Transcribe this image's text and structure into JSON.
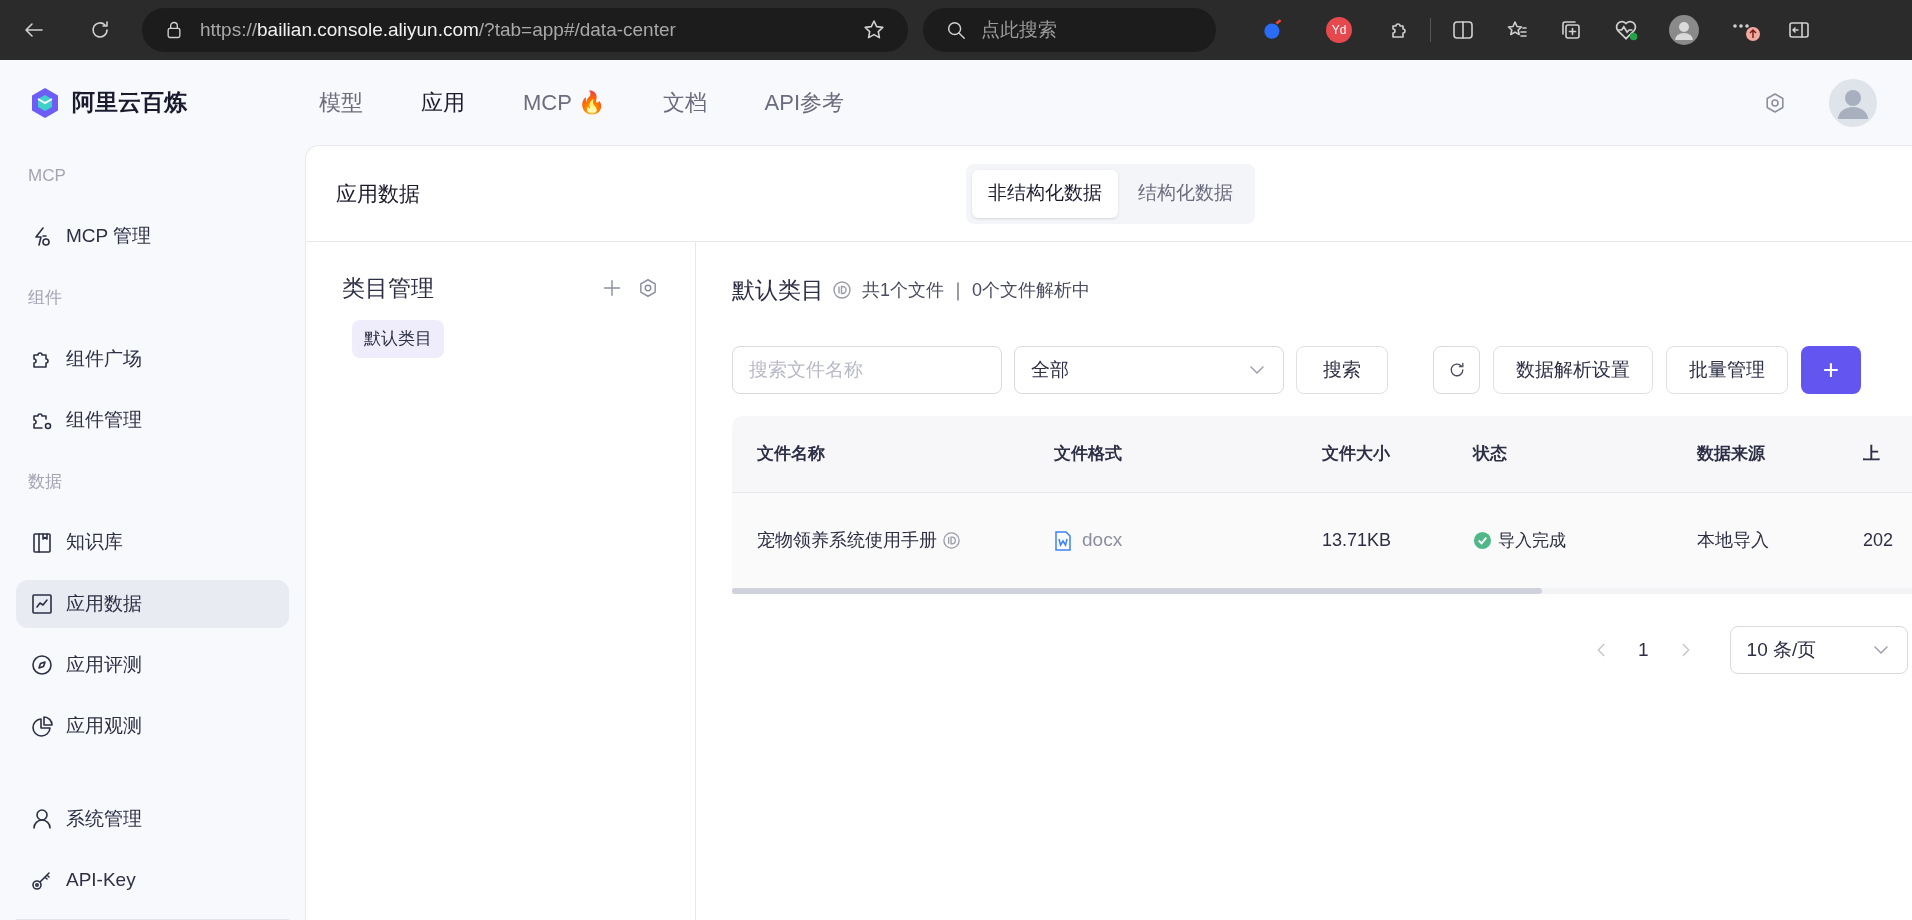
{
  "browser": {
    "url": {
      "prefix": "https://",
      "domain": "bailian.console.aliyun.com",
      "path": "/?tab=app#/data-center"
    },
    "search_placeholder": "点此搜索",
    "extension_badge": "Yd"
  },
  "header": {
    "brand": "阿里云百炼",
    "nav": [
      {
        "label": "模型",
        "selected": false
      },
      {
        "label": "应用",
        "selected": true
      },
      {
        "label": "MCP 🔥",
        "selected": false
      },
      {
        "label": "文档",
        "selected": false
      },
      {
        "label": "API参考",
        "selected": false
      }
    ]
  },
  "sidebar": {
    "entries": [
      {
        "kind": "heading",
        "label": "MCP"
      },
      {
        "kind": "item",
        "label": "MCP 管理",
        "selected": false
      },
      {
        "kind": "heading",
        "label": "组件"
      },
      {
        "kind": "item",
        "label": "组件广场",
        "selected": false
      },
      {
        "kind": "item",
        "label": "组件管理",
        "selected": false
      },
      {
        "kind": "heading",
        "label": "数据"
      },
      {
        "kind": "item",
        "label": "知识库",
        "selected": false
      },
      {
        "kind": "item",
        "label": "应用数据",
        "selected": true
      },
      {
        "kind": "item",
        "label": "应用评测",
        "selected": false
      },
      {
        "kind": "item",
        "label": "应用观测",
        "selected": false
      },
      {
        "kind": "spacer"
      },
      {
        "kind": "item",
        "label": "系统管理",
        "selected": false
      },
      {
        "kind": "item",
        "label": "API-Key",
        "selected": false
      }
    ]
  },
  "panel": {
    "title": "应用数据",
    "tabs": [
      {
        "label": "非结构化数据",
        "selected": true
      },
      {
        "label": "结构化数据",
        "selected": false
      }
    ]
  },
  "categories": {
    "title": "类目管理",
    "items": [
      {
        "label": "默认类目",
        "selected": true
      }
    ]
  },
  "content": {
    "title": "默认类目",
    "summary": "共1个文件 ｜ 0个文件解析中",
    "search": {
      "placeholder": "搜索文件名称"
    },
    "filter": {
      "value": "全部"
    },
    "search_button": "搜索",
    "buttons": [
      "数据解析设置",
      "批量管理"
    ],
    "add_button": "+",
    "table": {
      "columns": [
        "文件名称",
        "文件格式",
        "文件大小",
        "状态",
        "数据来源",
        "上"
      ],
      "rows": [
        {
          "name": "宠物领养系统使用手册",
          "format": "docx",
          "size": "13.71KB",
          "status": "导入完成",
          "source": "本地导入",
          "column_6": "202"
        }
      ]
    },
    "pagination": {
      "page": "1",
      "page_size": "10 条/页"
    }
  }
}
